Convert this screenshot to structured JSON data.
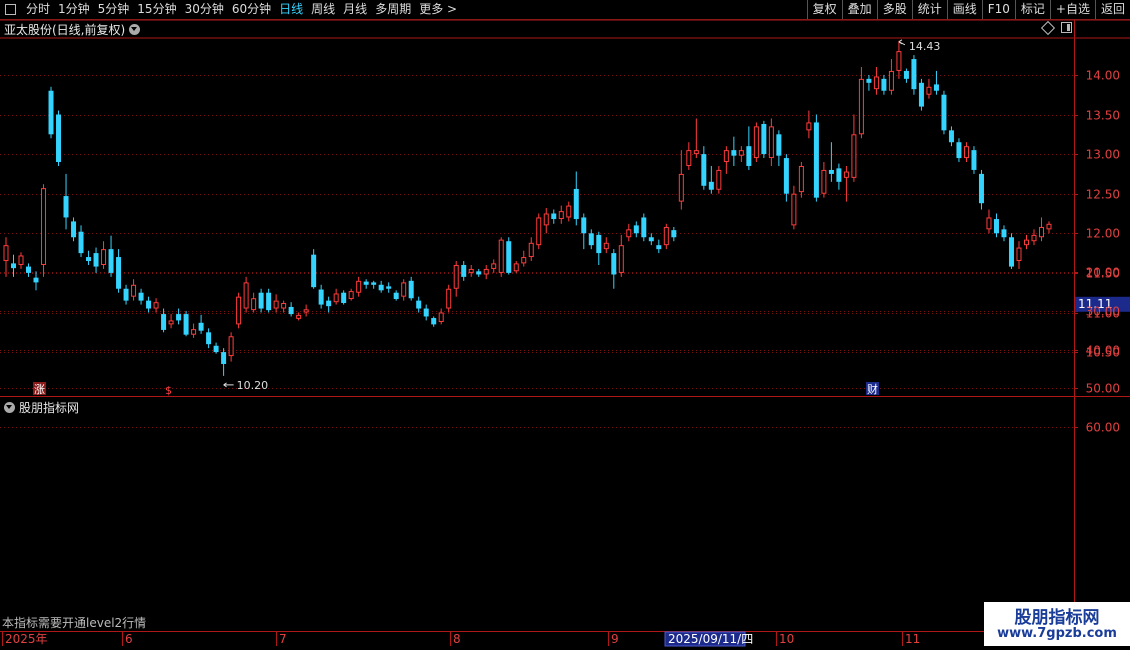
{
  "toolbar": {
    "periods": [
      "分时",
      "1分钟",
      "5分钟",
      "15分钟",
      "30分钟",
      "60分钟",
      "日线",
      "周线",
      "月线",
      "多周期",
      "更多 >"
    ],
    "active_period": "日线",
    "right_buttons": [
      "复权",
      "叠加",
      "多股",
      "统计",
      "画线",
      "F10",
      "标记",
      "+自选",
      "返回"
    ]
  },
  "stock": {
    "title": "亚太股份(日线,前复权)"
  },
  "price_axis": {
    "labels": [
      "14.00",
      "13.50",
      "13.00",
      "12.50",
      "12.00",
      "11.50",
      "11.00",
      "10.50"
    ]
  },
  "current_price": "11.11",
  "annotations": {
    "high": "14.43",
    "low": "10.20"
  },
  "markers": {
    "up": "涨",
    "dollar": "$",
    "finance": "财"
  },
  "indicator": {
    "name": "股朋指标网",
    "axis_labels": [
      "60.00",
      "50.00",
      "40.00",
      "30.00",
      "20.00"
    ],
    "notice": "本指标需要开通level2行情"
  },
  "date_axis": {
    "labels": [
      "2025年",
      "6",
      "7",
      "8",
      "9",
      "10",
      "11"
    ],
    "cursor_date": "2025/09/11/四"
  },
  "watermark": {
    "line1": "股朋指标网",
    "line2": "www.7gpzb.com"
  },
  "colors": {
    "up": "#ff3c3c",
    "down": "#35d4ff",
    "grid": "#7a1010",
    "axis": "#b01818",
    "cursor_bg": "#1c2a8c"
  },
  "chart_data": {
    "type": "candlestick",
    "candles": [
      [
        11.65,
        11.85,
        11.45,
        11.95
      ],
      [
        11.62,
        11.56,
        11.45,
        11.73
      ],
      [
        11.6,
        11.72,
        11.55,
        11.76
      ],
      [
        11.58,
        11.5,
        11.45,
        11.62
      ],
      [
        11.44,
        11.38,
        11.28,
        11.52
      ],
      [
        11.6,
        12.57,
        11.45,
        12.62
      ],
      [
        13.8,
        13.25,
        13.2,
        13.85
      ],
      [
        13.5,
        12.9,
        12.85,
        13.55
      ],
      [
        12.47,
        12.2,
        12.05,
        12.75
      ],
      [
        12.15,
        11.95,
        11.9,
        12.2
      ],
      [
        12.02,
        11.75,
        11.7,
        12.1
      ],
      [
        11.7,
        11.65,
        11.6,
        11.78
      ],
      [
        11.75,
        11.58,
        11.5,
        11.82
      ],
      [
        11.6,
        11.8,
        11.55,
        11.9
      ],
      [
        11.8,
        11.5,
        11.45,
        11.97
      ],
      [
        11.7,
        11.3,
        11.25,
        11.8
      ],
      [
        11.3,
        11.15,
        11.1,
        11.35
      ],
      [
        11.2,
        11.35,
        11.15,
        11.42
      ],
      [
        11.25,
        11.15,
        11.1,
        11.3
      ],
      [
        11.15,
        11.05,
        11.0,
        11.2
      ],
      [
        11.05,
        11.13,
        11.0,
        11.18
      ],
      [
        10.98,
        10.78,
        10.75,
        11.05
      ],
      [
        10.85,
        10.9,
        10.8,
        10.98
      ],
      [
        10.98,
        10.9,
        10.85,
        11.05
      ],
      [
        10.98,
        10.72,
        10.7,
        11.02
      ],
      [
        10.72,
        10.79,
        10.68,
        10.86
      ],
      [
        10.87,
        10.77,
        10.73,
        10.97
      ],
      [
        10.75,
        10.6,
        10.55,
        10.8
      ],
      [
        10.58,
        10.5,
        10.48,
        10.62
      ],
      [
        10.5,
        10.35,
        10.2,
        10.55
      ],
      [
        10.45,
        10.7,
        10.38,
        10.75
      ],
      [
        10.85,
        11.2,
        10.8,
        11.25
      ],
      [
        11.05,
        11.38,
        11.0,
        11.45
      ],
      [
        11.03,
        11.18,
        11.0,
        11.25
      ],
      [
        11.25,
        11.05,
        11.0,
        11.3
      ],
      [
        11.25,
        11.03,
        11.0,
        11.3
      ],
      [
        11.05,
        11.15,
        11.0,
        11.23
      ],
      [
        11.05,
        11.12,
        11.0,
        11.15
      ],
      [
        11.07,
        10.98,
        10.95,
        11.13
      ],
      [
        10.92,
        10.97,
        10.9,
        11.0
      ],
      [
        11.0,
        11.04,
        10.95,
        11.1
      ],
      [
        11.73,
        11.32,
        11.3,
        11.8
      ],
      [
        11.29,
        11.1,
        11.05,
        11.35
      ],
      [
        11.15,
        11.08,
        11.0,
        11.2
      ],
      [
        11.13,
        11.24,
        11.1,
        11.3
      ],
      [
        11.25,
        11.12,
        11.1,
        11.28
      ],
      [
        11.17,
        11.27,
        11.15,
        11.3
      ],
      [
        11.25,
        11.4,
        11.2,
        11.45
      ],
      [
        11.39,
        11.35,
        11.3,
        11.42
      ],
      [
        11.38,
        11.35,
        11.3,
        11.4
      ],
      [
        11.35,
        11.28,
        11.25,
        11.4
      ],
      [
        11.33,
        11.3,
        11.25,
        11.38
      ],
      [
        11.25,
        11.17,
        11.15,
        11.28
      ],
      [
        11.2,
        11.38,
        11.15,
        11.42
      ],
      [
        11.4,
        11.18,
        11.15,
        11.45
      ],
      [
        11.15,
        11.05,
        11.0,
        11.2
      ],
      [
        11.05,
        10.95,
        10.9,
        11.1
      ],
      [
        10.93,
        10.85,
        10.82,
        10.95
      ],
      [
        10.88,
        11.0,
        10.85,
        11.05
      ],
      [
        11.05,
        11.3,
        11.0,
        11.35
      ],
      [
        11.3,
        11.6,
        11.2,
        11.65
      ],
      [
        11.6,
        11.45,
        11.4,
        11.65
      ],
      [
        11.5,
        11.55,
        11.45,
        11.6
      ],
      [
        11.52,
        11.48,
        11.45,
        11.55
      ],
      [
        11.48,
        11.55,
        11.42,
        11.6
      ],
      [
        11.55,
        11.62,
        11.5,
        11.67
      ],
      [
        11.5,
        11.92,
        11.45,
        11.95
      ],
      [
        11.9,
        11.5,
        11.48,
        11.95
      ],
      [
        11.52,
        11.62,
        11.5,
        11.65
      ],
      [
        11.62,
        11.7,
        11.58,
        11.78
      ],
      [
        11.7,
        11.88,
        11.65,
        11.95
      ],
      [
        11.85,
        12.2,
        11.8,
        12.25
      ],
      [
        12.1,
        12.25,
        12.0,
        12.32
      ],
      [
        12.25,
        12.18,
        12.12,
        12.3
      ],
      [
        12.18,
        12.28,
        12.12,
        12.35
      ],
      [
        12.2,
        12.35,
        12.15,
        12.4
      ],
      [
        12.56,
        12.18,
        12.1,
        12.78
      ],
      [
        12.2,
        12.0,
        11.8,
        12.25
      ],
      [
        12.0,
        11.85,
        11.8,
        12.05
      ],
      [
        11.98,
        11.75,
        11.6,
        12.02
      ],
      [
        11.8,
        11.88,
        11.75,
        11.95
      ],
      [
        11.75,
        11.48,
        11.3,
        11.8
      ],
      [
        11.5,
        11.85,
        11.45,
        11.98
      ],
      [
        11.95,
        12.05,
        11.9,
        12.12
      ],
      [
        12.1,
        12.0,
        11.95,
        12.15
      ],
      [
        12.2,
        11.95,
        11.9,
        12.25
      ],
      [
        11.95,
        11.9,
        11.85,
        12.0
      ],
      [
        11.85,
        11.8,
        11.75,
        11.92
      ],
      [
        11.85,
        12.08,
        11.8,
        12.12
      ],
      [
        12.04,
        11.95,
        11.9,
        12.08
      ],
      [
        12.4,
        12.75,
        12.3,
        13.05
      ],
      [
        12.85,
        13.05,
        12.8,
        13.15
      ],
      [
        13.0,
        13.05,
        12.95,
        13.45
      ],
      [
        13.0,
        12.6,
        12.55,
        13.1
      ],
      [
        12.65,
        12.55,
        12.5,
        12.85
      ],
      [
        12.55,
        12.8,
        12.5,
        12.85
      ],
      [
        12.9,
        13.05,
        12.75,
        13.1
      ],
      [
        13.05,
        12.98,
        12.85,
        13.22
      ],
      [
        12.98,
        13.05,
        12.9,
        13.1
      ],
      [
        13.1,
        12.85,
        12.8,
        13.35
      ],
      [
        12.95,
        13.35,
        12.9,
        13.4
      ],
      [
        13.38,
        13.0,
        12.95,
        13.42
      ],
      [
        12.95,
        13.35,
        12.85,
        13.45
      ],
      [
        13.25,
        12.98,
        12.85,
        13.3
      ],
      [
        12.95,
        12.5,
        12.4,
        13.0
      ],
      [
        12.1,
        12.5,
        12.05,
        12.6
      ],
      [
        12.52,
        12.85,
        12.45,
        12.9
      ],
      [
        13.3,
        13.4,
        13.2,
        13.55
      ],
      [
        13.4,
        12.45,
        12.4,
        13.5
      ],
      [
        12.5,
        12.8,
        12.45,
        12.9
      ],
      [
        12.8,
        12.75,
        12.65,
        13.15
      ],
      [
        12.82,
        12.65,
        12.55,
        12.88
      ],
      [
        12.7,
        12.78,
        12.4,
        12.85
      ],
      [
        12.7,
        13.25,
        12.65,
        13.5
      ],
      [
        13.25,
        13.95,
        13.2,
        14.1
      ],
      [
        13.95,
        13.9,
        13.8,
        14.0
      ],
      [
        13.82,
        13.98,
        13.75,
        14.1
      ],
      [
        13.95,
        13.8,
        13.75,
        14.0
      ],
      [
        13.8,
        14.05,
        13.75,
        14.2
      ],
      [
        14.05,
        14.3,
        13.95,
        14.43
      ],
      [
        14.05,
        13.95,
        13.9,
        14.08
      ],
      [
        14.2,
        13.82,
        13.75,
        14.25
      ],
      [
        13.9,
        13.6,
        13.55,
        13.95
      ],
      [
        13.75,
        13.85,
        13.7,
        13.95
      ],
      [
        13.88,
        13.8,
        13.75,
        14.05
      ],
      [
        13.75,
        13.3,
        13.25,
        13.8
      ],
      [
        13.3,
        13.15,
        13.1,
        13.35
      ],
      [
        13.15,
        12.95,
        12.9,
        13.2
      ],
      [
        12.95,
        13.1,
        12.9,
        13.15
      ],
      [
        13.05,
        12.8,
        12.75,
        13.1
      ],
      [
        12.75,
        12.38,
        12.3,
        12.8
      ],
      [
        12.05,
        12.2,
        12.0,
        12.3
      ],
      [
        12.18,
        12.0,
        11.95,
        12.25
      ],
      [
        12.05,
        11.95,
        11.9,
        12.1
      ],
      [
        11.95,
        11.58,
        11.55,
        12.0
      ],
      [
        11.65,
        11.82,
        11.55,
        11.9
      ],
      [
        11.85,
        11.92,
        11.8,
        11.98
      ],
      [
        11.9,
        11.98,
        11.85,
        12.05
      ],
      [
        11.95,
        12.08,
        11.9,
        12.2
      ],
      [
        12.05,
        12.12,
        12.0,
        12.15
      ]
    ],
    "candle_format": [
      "open",
      "close",
      "low",
      "high"
    ],
    "y_axis": {
      "range": [
        10.0,
        14.6
      ],
      "ticks": [
        14.0,
        13.5,
        13.0,
        12.5,
        12.0,
        11.5,
        11.0,
        10.5
      ]
    },
    "indicator_axis": {
      "ticks": [
        60,
        50,
        40,
        30,
        20
      ]
    },
    "x_month_labels": [
      "2025年",
      "6",
      "7",
      "8",
      "9",
      "10",
      "11"
    ],
    "high_label": 14.43,
    "low_label": 10.2
  }
}
